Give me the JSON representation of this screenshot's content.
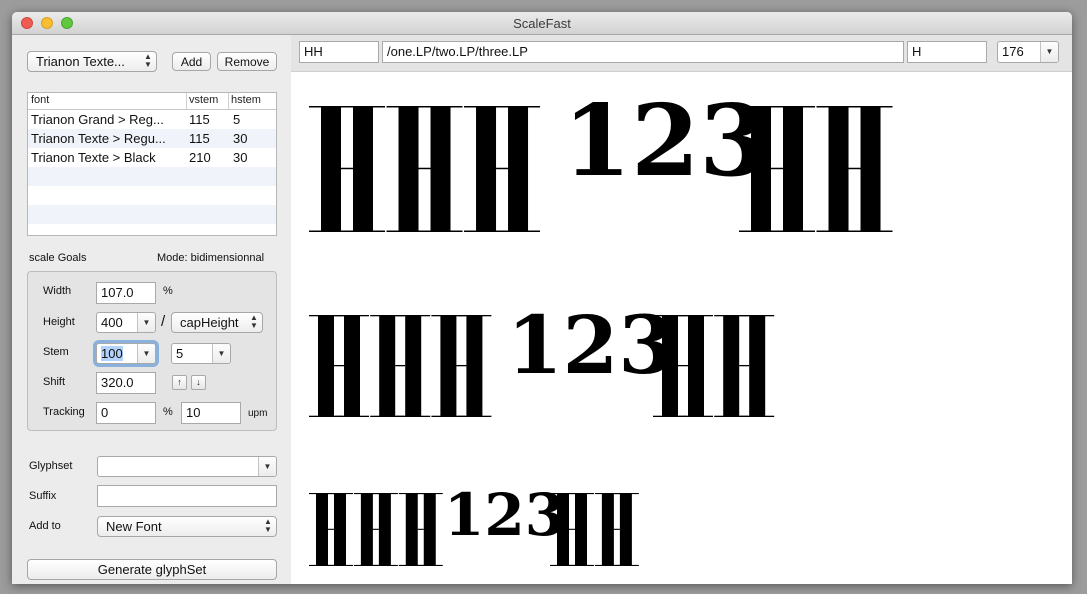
{
  "window": {
    "title": "ScaleFast"
  },
  "font_selector": {
    "value": "Trianon Texte..."
  },
  "buttons": {
    "add": "Add",
    "remove": "Remove",
    "generate": "Generate glyphSet"
  },
  "font_table": {
    "headers": [
      "font",
      "vstem",
      "hstem"
    ],
    "rows": [
      {
        "font": "Trianon Grand > Reg...",
        "vstem": "115",
        "hstem": "5"
      },
      {
        "font": "Trianon Texte > Regu...",
        "vstem": "115",
        "hstem": "30"
      },
      {
        "font": "Trianon Texte > Black",
        "vstem": "210",
        "hstem": "30"
      }
    ]
  },
  "scale_goals": {
    "heading": "scale Goals",
    "mode": "Mode: bidimensionnal",
    "width_label": "Width",
    "width_value": "107.0",
    "width_unit": "%",
    "height_label": "Height",
    "height_value": "400",
    "height_separator": "/",
    "height_reference": "capHeight",
    "stem_label": "Stem",
    "stem_vertical": "100",
    "stem_horizontal": "5",
    "shift_label": "Shift",
    "shift_value": "320.0",
    "shift_up_glyph": "↑",
    "shift_down_glyph": "↓",
    "tracking_label": "Tracking",
    "tracking_percent_value": "0",
    "tracking_percent_unit": "%",
    "tracking_units_value": "10",
    "tracking_units_unit": "upm"
  },
  "options": {
    "glyphset_label": "Glyphset",
    "glyphset_value": "",
    "suffix_label": "Suffix",
    "suffix_value": "",
    "addto_label": "Add to",
    "addto_value": "New Font"
  },
  "preview_controls": {
    "string": "HH",
    "glyph_names": "/one.LP/two.LP/three.LP",
    "trailing": "H",
    "point_size": "176"
  },
  "preview_glyphs": {
    "letters": "H",
    "figures": "123"
  },
  "colors": {
    "selection": "#b3d2fb",
    "focus_ring": "#6ca0dc",
    "table_alt_row": "#f0f4fa"
  }
}
